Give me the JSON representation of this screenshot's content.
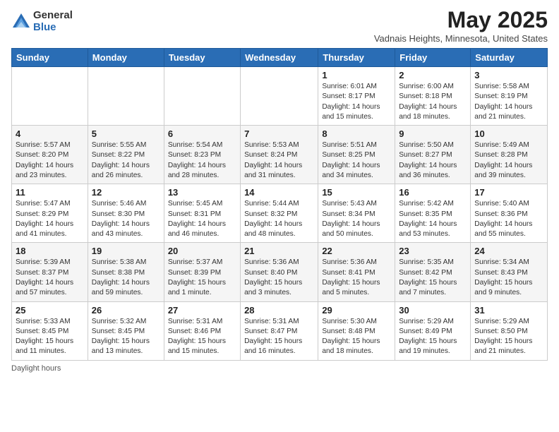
{
  "logo": {
    "general": "General",
    "blue": "Blue"
  },
  "title": "May 2025",
  "location": "Vadnais Heights, Minnesota, United States",
  "headers": [
    "Sunday",
    "Monday",
    "Tuesday",
    "Wednesday",
    "Thursday",
    "Friday",
    "Saturday"
  ],
  "footer": "Daylight hours",
  "weeks": [
    [
      {
        "day": "",
        "info": ""
      },
      {
        "day": "",
        "info": ""
      },
      {
        "day": "",
        "info": ""
      },
      {
        "day": "",
        "info": ""
      },
      {
        "day": "1",
        "info": "Sunrise: 6:01 AM\nSunset: 8:17 PM\nDaylight: 14 hours\nand 15 minutes."
      },
      {
        "day": "2",
        "info": "Sunrise: 6:00 AM\nSunset: 8:18 PM\nDaylight: 14 hours\nand 18 minutes."
      },
      {
        "day": "3",
        "info": "Sunrise: 5:58 AM\nSunset: 8:19 PM\nDaylight: 14 hours\nand 21 minutes."
      }
    ],
    [
      {
        "day": "4",
        "info": "Sunrise: 5:57 AM\nSunset: 8:20 PM\nDaylight: 14 hours\nand 23 minutes."
      },
      {
        "day": "5",
        "info": "Sunrise: 5:55 AM\nSunset: 8:22 PM\nDaylight: 14 hours\nand 26 minutes."
      },
      {
        "day": "6",
        "info": "Sunrise: 5:54 AM\nSunset: 8:23 PM\nDaylight: 14 hours\nand 28 minutes."
      },
      {
        "day": "7",
        "info": "Sunrise: 5:53 AM\nSunset: 8:24 PM\nDaylight: 14 hours\nand 31 minutes."
      },
      {
        "day": "8",
        "info": "Sunrise: 5:51 AM\nSunset: 8:25 PM\nDaylight: 14 hours\nand 34 minutes."
      },
      {
        "day": "9",
        "info": "Sunrise: 5:50 AM\nSunset: 8:27 PM\nDaylight: 14 hours\nand 36 minutes."
      },
      {
        "day": "10",
        "info": "Sunrise: 5:49 AM\nSunset: 8:28 PM\nDaylight: 14 hours\nand 39 minutes."
      }
    ],
    [
      {
        "day": "11",
        "info": "Sunrise: 5:47 AM\nSunset: 8:29 PM\nDaylight: 14 hours\nand 41 minutes."
      },
      {
        "day": "12",
        "info": "Sunrise: 5:46 AM\nSunset: 8:30 PM\nDaylight: 14 hours\nand 43 minutes."
      },
      {
        "day": "13",
        "info": "Sunrise: 5:45 AM\nSunset: 8:31 PM\nDaylight: 14 hours\nand 46 minutes."
      },
      {
        "day": "14",
        "info": "Sunrise: 5:44 AM\nSunset: 8:32 PM\nDaylight: 14 hours\nand 48 minutes."
      },
      {
        "day": "15",
        "info": "Sunrise: 5:43 AM\nSunset: 8:34 PM\nDaylight: 14 hours\nand 50 minutes."
      },
      {
        "day": "16",
        "info": "Sunrise: 5:42 AM\nSunset: 8:35 PM\nDaylight: 14 hours\nand 53 minutes."
      },
      {
        "day": "17",
        "info": "Sunrise: 5:40 AM\nSunset: 8:36 PM\nDaylight: 14 hours\nand 55 minutes."
      }
    ],
    [
      {
        "day": "18",
        "info": "Sunrise: 5:39 AM\nSunset: 8:37 PM\nDaylight: 14 hours\nand 57 minutes."
      },
      {
        "day": "19",
        "info": "Sunrise: 5:38 AM\nSunset: 8:38 PM\nDaylight: 14 hours\nand 59 minutes."
      },
      {
        "day": "20",
        "info": "Sunrise: 5:37 AM\nSunset: 8:39 PM\nDaylight: 15 hours\nand 1 minute."
      },
      {
        "day": "21",
        "info": "Sunrise: 5:36 AM\nSunset: 8:40 PM\nDaylight: 15 hours\nand 3 minutes."
      },
      {
        "day": "22",
        "info": "Sunrise: 5:36 AM\nSunset: 8:41 PM\nDaylight: 15 hours\nand 5 minutes."
      },
      {
        "day": "23",
        "info": "Sunrise: 5:35 AM\nSunset: 8:42 PM\nDaylight: 15 hours\nand 7 minutes."
      },
      {
        "day": "24",
        "info": "Sunrise: 5:34 AM\nSunset: 8:43 PM\nDaylight: 15 hours\nand 9 minutes."
      }
    ],
    [
      {
        "day": "25",
        "info": "Sunrise: 5:33 AM\nSunset: 8:45 PM\nDaylight: 15 hours\nand 11 minutes."
      },
      {
        "day": "26",
        "info": "Sunrise: 5:32 AM\nSunset: 8:45 PM\nDaylight: 15 hours\nand 13 minutes."
      },
      {
        "day": "27",
        "info": "Sunrise: 5:31 AM\nSunset: 8:46 PM\nDaylight: 15 hours\nand 15 minutes."
      },
      {
        "day": "28",
        "info": "Sunrise: 5:31 AM\nSunset: 8:47 PM\nDaylight: 15 hours\nand 16 minutes."
      },
      {
        "day": "29",
        "info": "Sunrise: 5:30 AM\nSunset: 8:48 PM\nDaylight: 15 hours\nand 18 minutes."
      },
      {
        "day": "30",
        "info": "Sunrise: 5:29 AM\nSunset: 8:49 PM\nDaylight: 15 hours\nand 19 minutes."
      },
      {
        "day": "31",
        "info": "Sunrise: 5:29 AM\nSunset: 8:50 PM\nDaylight: 15 hours\nand 21 minutes."
      }
    ]
  ]
}
